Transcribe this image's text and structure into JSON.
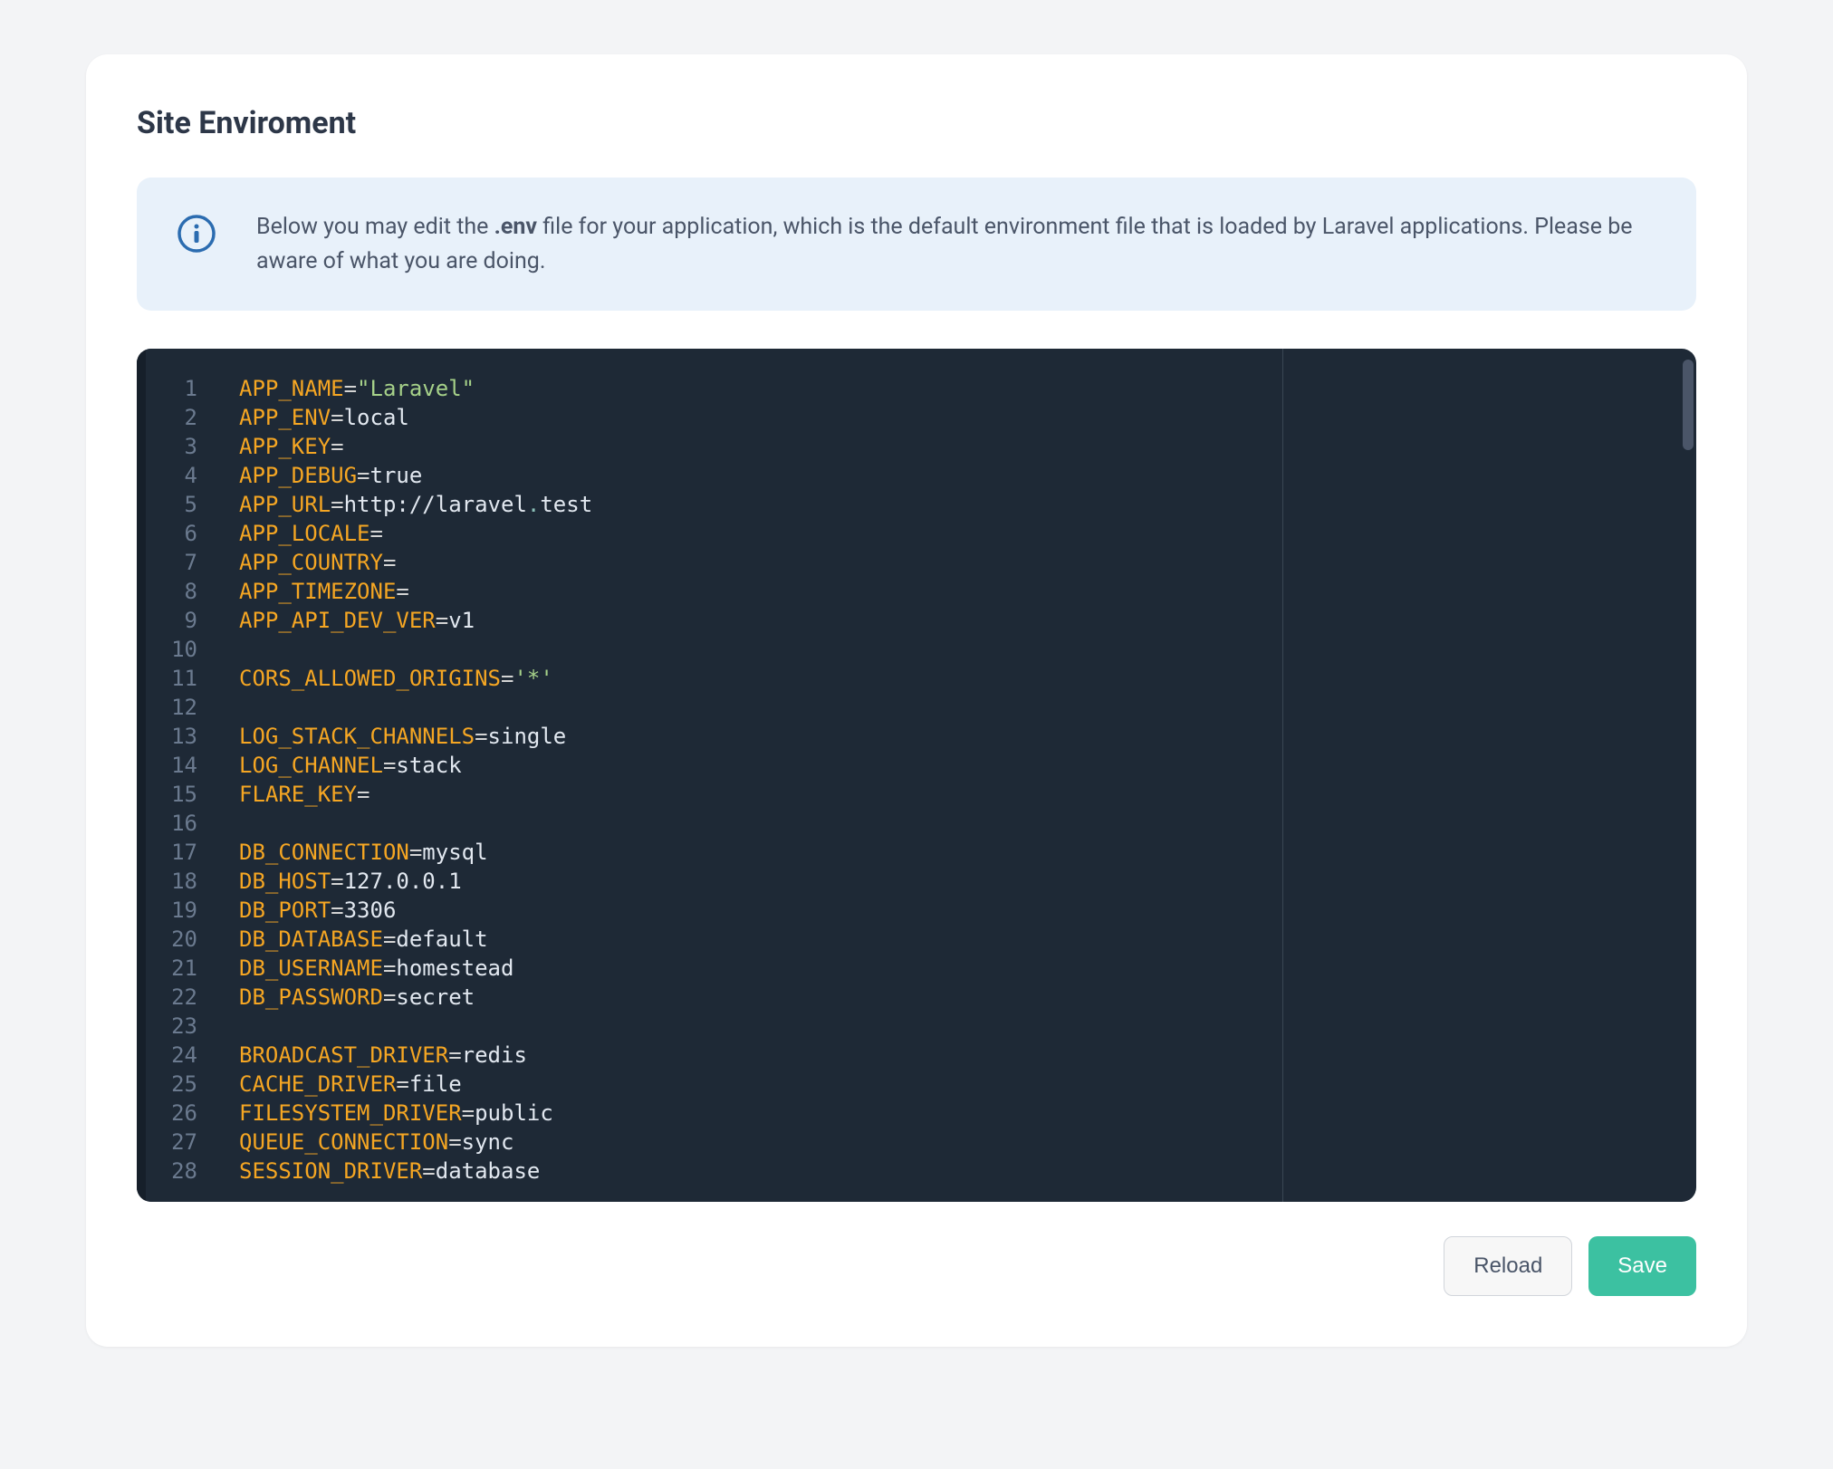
{
  "page_title": "Site Enviroment",
  "info_banner": {
    "text_before": "Below you may edit the ",
    "text_bold": ".env",
    "text_after": " file for your application, which is the default environment file that is loaded by Laravel applications. Please be aware of what you are doing."
  },
  "code": {
    "lines": [
      {
        "num": "1",
        "tokens": [
          {
            "t": "key",
            "v": "APP_NAME"
          },
          {
            "t": "eq",
            "v": "="
          },
          {
            "t": "string",
            "v": "\"Laravel\""
          }
        ]
      },
      {
        "num": "2",
        "tokens": [
          {
            "t": "key",
            "v": "APP_ENV"
          },
          {
            "t": "eq",
            "v": "="
          },
          {
            "t": "value",
            "v": "local"
          }
        ]
      },
      {
        "num": "3",
        "tokens": [
          {
            "t": "key",
            "v": "APP_KEY"
          },
          {
            "t": "eq",
            "v": "="
          }
        ]
      },
      {
        "num": "4",
        "tokens": [
          {
            "t": "key",
            "v": "APP_DEBUG"
          },
          {
            "t": "eq",
            "v": "="
          },
          {
            "t": "value",
            "v": "true"
          }
        ]
      },
      {
        "num": "5",
        "tokens": [
          {
            "t": "key",
            "v": "APP_URL"
          },
          {
            "t": "eq",
            "v": "="
          },
          {
            "t": "value",
            "v": "http://laravel"
          },
          {
            "t": "punct",
            "v": "."
          },
          {
            "t": "value",
            "v": "test"
          }
        ]
      },
      {
        "num": "6",
        "tokens": [
          {
            "t": "key",
            "v": "APP_LOCALE"
          },
          {
            "t": "eq",
            "v": "="
          }
        ]
      },
      {
        "num": "7",
        "tokens": [
          {
            "t": "key",
            "v": "APP_COUNTRY"
          },
          {
            "t": "eq",
            "v": "="
          }
        ]
      },
      {
        "num": "8",
        "tokens": [
          {
            "t": "key",
            "v": "APP_TIMEZONE"
          },
          {
            "t": "eq",
            "v": "="
          }
        ]
      },
      {
        "num": "9",
        "tokens": [
          {
            "t": "key",
            "v": "APP_API_DEV_VER"
          },
          {
            "t": "eq",
            "v": "="
          },
          {
            "t": "value",
            "v": "v1"
          }
        ]
      },
      {
        "num": "10",
        "tokens": []
      },
      {
        "num": "11",
        "tokens": [
          {
            "t": "key",
            "v": "CORS_ALLOWED_ORIGINS"
          },
          {
            "t": "eq",
            "v": "="
          },
          {
            "t": "string",
            "v": "'*'"
          }
        ]
      },
      {
        "num": "12",
        "tokens": []
      },
      {
        "num": "13",
        "tokens": [
          {
            "t": "key",
            "v": "LOG_STACK_CHANNELS"
          },
          {
            "t": "eq",
            "v": "="
          },
          {
            "t": "value",
            "v": "single"
          }
        ]
      },
      {
        "num": "14",
        "tokens": [
          {
            "t": "key",
            "v": "LOG_CHANNEL"
          },
          {
            "t": "eq",
            "v": "="
          },
          {
            "t": "value",
            "v": "stack"
          }
        ]
      },
      {
        "num": "15",
        "tokens": [
          {
            "t": "key",
            "v": "FLARE_KEY"
          },
          {
            "t": "eq",
            "v": "="
          }
        ]
      },
      {
        "num": "16",
        "tokens": []
      },
      {
        "num": "17",
        "tokens": [
          {
            "t": "key",
            "v": "DB_CONNECTION"
          },
          {
            "t": "eq",
            "v": "="
          },
          {
            "t": "value",
            "v": "mysql"
          }
        ]
      },
      {
        "num": "18",
        "tokens": [
          {
            "t": "key",
            "v": "DB_HOST"
          },
          {
            "t": "eq",
            "v": "="
          },
          {
            "t": "value",
            "v": "127.0.0.1"
          }
        ]
      },
      {
        "num": "19",
        "tokens": [
          {
            "t": "key",
            "v": "DB_PORT"
          },
          {
            "t": "eq",
            "v": "="
          },
          {
            "t": "value",
            "v": "3306"
          }
        ]
      },
      {
        "num": "20",
        "tokens": [
          {
            "t": "key",
            "v": "DB_DATABASE"
          },
          {
            "t": "eq",
            "v": "="
          },
          {
            "t": "value",
            "v": "default"
          }
        ]
      },
      {
        "num": "21",
        "tokens": [
          {
            "t": "key",
            "v": "DB_USERNAME"
          },
          {
            "t": "eq",
            "v": "="
          },
          {
            "t": "value",
            "v": "homestead"
          }
        ]
      },
      {
        "num": "22",
        "tokens": [
          {
            "t": "key",
            "v": "DB_PASSWORD"
          },
          {
            "t": "eq",
            "v": "="
          },
          {
            "t": "value",
            "v": "secret"
          }
        ]
      },
      {
        "num": "23",
        "tokens": []
      },
      {
        "num": "24",
        "tokens": [
          {
            "t": "key",
            "v": "BROADCAST_DRIVER"
          },
          {
            "t": "eq",
            "v": "="
          },
          {
            "t": "value",
            "v": "redis"
          }
        ]
      },
      {
        "num": "25",
        "tokens": [
          {
            "t": "key",
            "v": "CACHE_DRIVER"
          },
          {
            "t": "eq",
            "v": "="
          },
          {
            "t": "value",
            "v": "file"
          }
        ]
      },
      {
        "num": "26",
        "tokens": [
          {
            "t": "key",
            "v": "FILESYSTEM_DRIVER"
          },
          {
            "t": "eq",
            "v": "="
          },
          {
            "t": "value",
            "v": "public"
          }
        ]
      },
      {
        "num": "27",
        "tokens": [
          {
            "t": "key",
            "v": "QUEUE_CONNECTION"
          },
          {
            "t": "eq",
            "v": "="
          },
          {
            "t": "value",
            "v": "sync"
          }
        ]
      },
      {
        "num": "28",
        "tokens": [
          {
            "t": "key",
            "v": "SESSION_DRIVER"
          },
          {
            "t": "eq",
            "v": "="
          },
          {
            "t": "value",
            "v": "database"
          }
        ]
      }
    ]
  },
  "buttons": {
    "reload": "Reload",
    "save": "Save"
  }
}
